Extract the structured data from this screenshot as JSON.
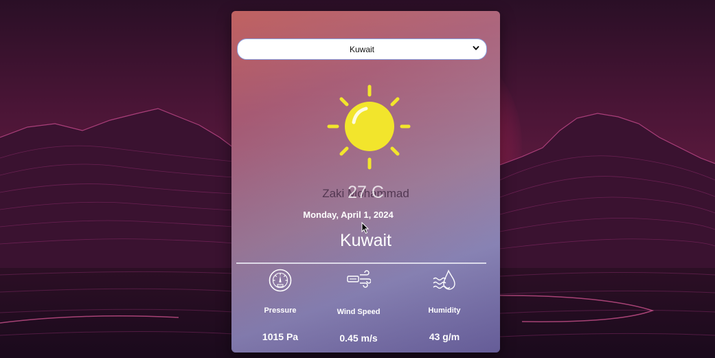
{
  "city_select": {
    "selected": "Kuwait"
  },
  "weather": {
    "icon": "sun-icon",
    "name_overlay": "Zaki Mohammad",
    "temperature": "27 C",
    "date": "Monday, April 1, 2024",
    "city": "Kuwait"
  },
  "stats": [
    {
      "icon": "pressure-gauge-icon",
      "label": "Pressure",
      "value": "1015 Pa"
    },
    {
      "icon": "wind-icon",
      "label": "Wind Speed",
      "value": "0.45 m/s"
    },
    {
      "icon": "humidity-icon",
      "label": "Humidity",
      "value": "43 g/m"
    }
  ],
  "colors": {
    "sun": "#f2e52c",
    "card_top": "#b9504f",
    "card_bottom": "#6e6aa5",
    "glow": "#e33c78"
  }
}
